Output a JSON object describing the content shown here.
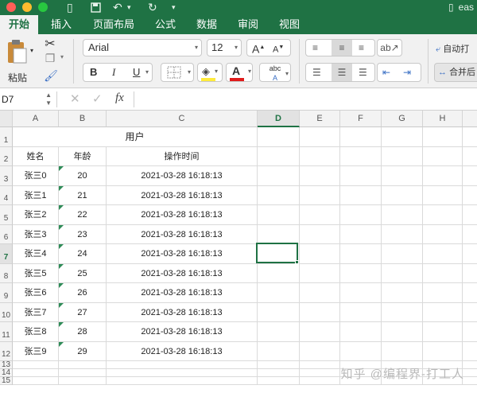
{
  "window": {
    "title_fragment": "eas",
    "doc_icon": "file-icon"
  },
  "toolbar_icons": [
    "file-icon",
    "save-icon",
    "undo-icon",
    "redo-icon",
    "dropdown-icon"
  ],
  "ribbon_tabs": [
    {
      "label": "开始",
      "active": true
    },
    {
      "label": "插入",
      "active": false
    },
    {
      "label": "页面布局",
      "active": false
    },
    {
      "label": "公式",
      "active": false
    },
    {
      "label": "数据",
      "active": false
    },
    {
      "label": "审阅",
      "active": false
    },
    {
      "label": "视图",
      "active": false
    }
  ],
  "ribbon": {
    "paste_label": "粘贴",
    "font_name": "Arial",
    "font_size": "12",
    "bold": "B",
    "italic": "I",
    "underline": "U",
    "font_grow": "A",
    "font_shrink": "A",
    "abc_label": "abc",
    "wrap_text": "自动换行",
    "wrap_text_visible": "自动打",
    "merge_label": "合并后",
    "font_color": "#e01b1b",
    "fill_color": "#ffeb3b"
  },
  "formula_bar": {
    "name_box": "D7",
    "fx": "fx",
    "cancel": "✕",
    "confirm": "✓",
    "value": ""
  },
  "columns": [
    "A",
    "B",
    "C",
    "D",
    "E",
    "F",
    "G",
    "H"
  ],
  "selected_column": "D",
  "selected_row": "7",
  "rows": [
    "1",
    "2",
    "3",
    "4",
    "5",
    "6",
    "7",
    "8",
    "9",
    "10",
    "11",
    "12",
    "13",
    "14",
    "15"
  ],
  "sheet": {
    "title": "用户",
    "headers": [
      "姓名",
      "年龄",
      "操作时间"
    ],
    "records": [
      {
        "name": "张三0",
        "age": "20",
        "time": "2021-03-28 16:18:13"
      },
      {
        "name": "张三1",
        "age": "21",
        "time": "2021-03-28 16:18:13"
      },
      {
        "name": "张三2",
        "age": "22",
        "time": "2021-03-28 16:18:13"
      },
      {
        "name": "张三3",
        "age": "23",
        "time": "2021-03-28 16:18:13"
      },
      {
        "name": "张三4",
        "age": "24",
        "time": "2021-03-28 16:18:13"
      },
      {
        "name": "张三5",
        "age": "25",
        "time": "2021-03-28 16:18:13"
      },
      {
        "name": "张三6",
        "age": "26",
        "time": "2021-03-28 16:18:13"
      },
      {
        "name": "张三7",
        "age": "27",
        "time": "2021-03-28 16:18:13"
      },
      {
        "name": "张三8",
        "age": "28",
        "time": "2021-03-28 16:18:13"
      },
      {
        "name": "张三9",
        "age": "29",
        "time": "2021-03-28 16:18:13"
      }
    ]
  },
  "watermark": "知乎 @编程界-打工人"
}
